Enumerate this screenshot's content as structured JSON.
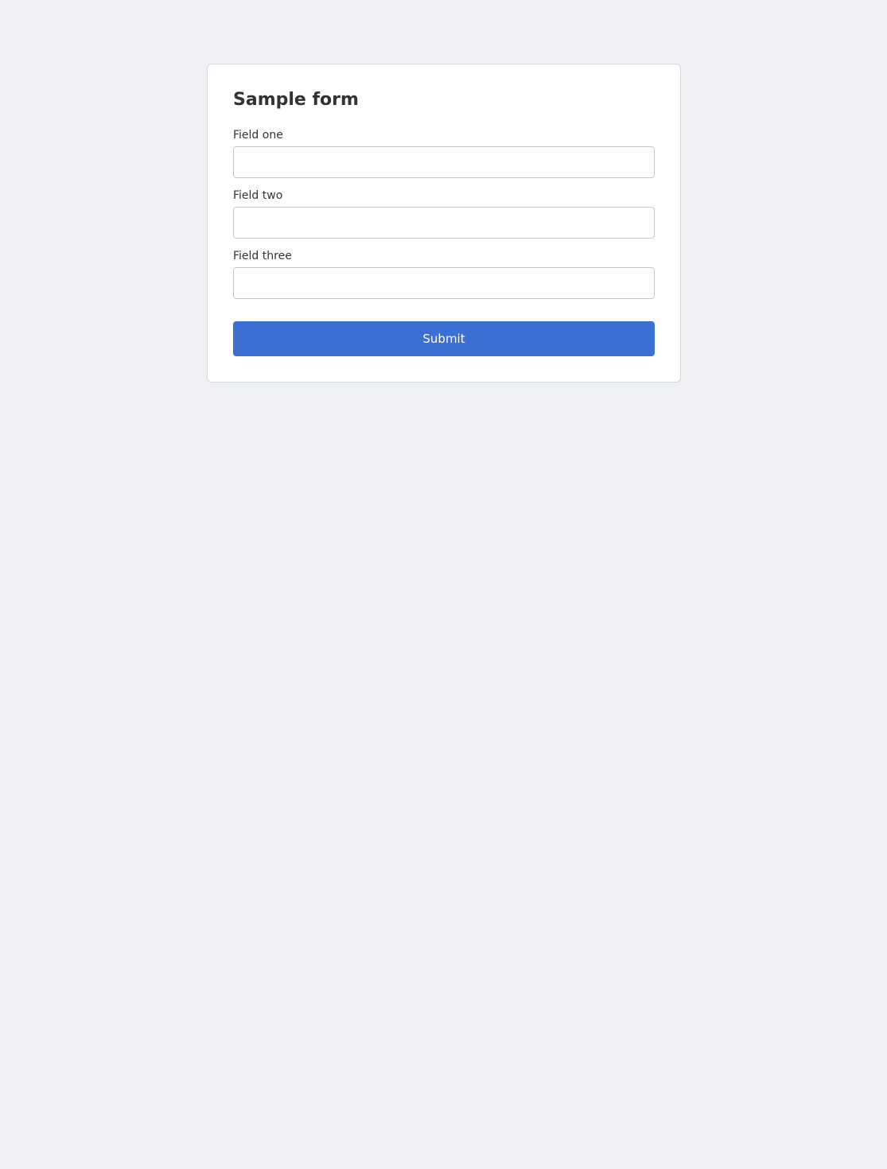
{
  "form": {
    "title": "Sample form",
    "fields": [
      {
        "label": "Field one",
        "value": ""
      },
      {
        "label": "Field two",
        "value": ""
      },
      {
        "label": "Field three",
        "value": ""
      }
    ],
    "submit_label": "Submit"
  }
}
